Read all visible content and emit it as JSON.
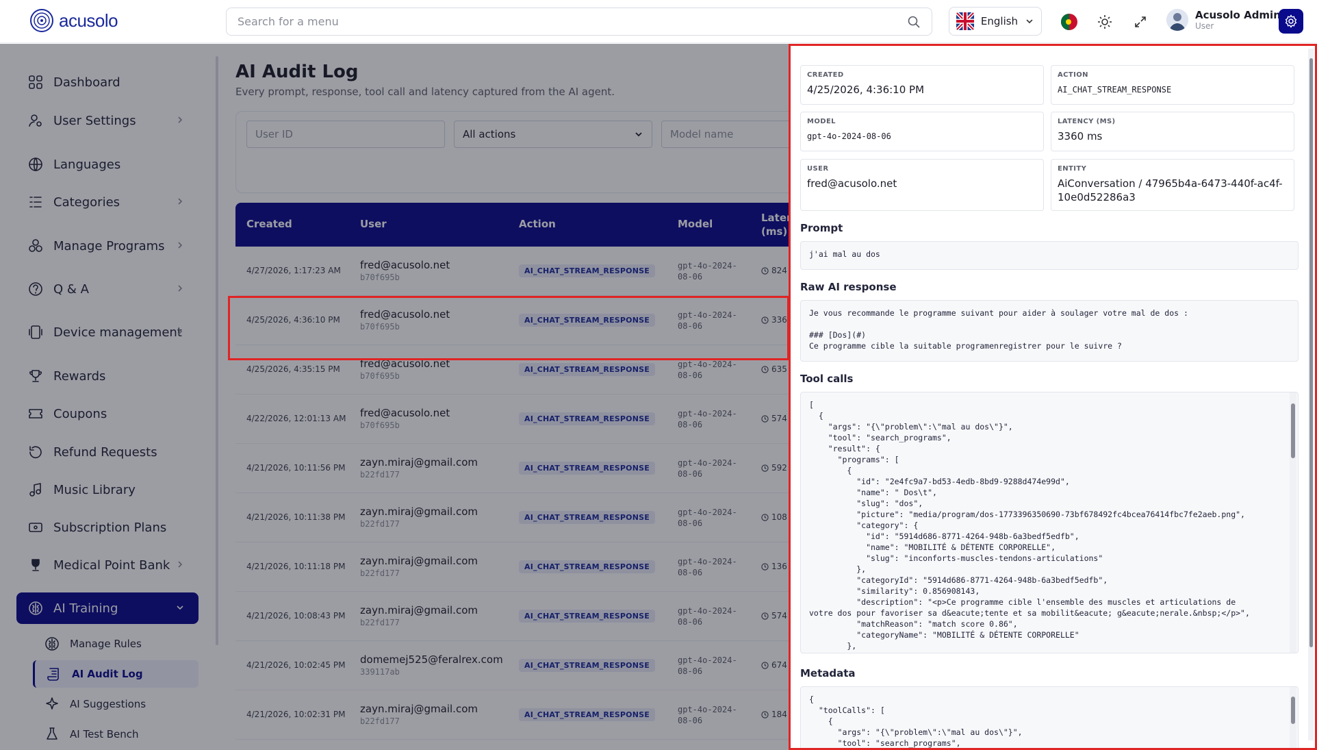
{
  "app": {
    "logo_text": "acusolo",
    "search_placeholder": "Search for a menu",
    "language": "English",
    "user_name": "Acusolo Admin",
    "user_role": "User"
  },
  "sidebar": {
    "items": [
      {
        "label": "Dashboard",
        "icon": "dashboard-icon",
        "chevron": false
      },
      {
        "label": "User Settings",
        "icon": "user-settings-icon",
        "chevron": true
      },
      {
        "label": "Languages",
        "icon": "globe-icon",
        "chevron": false
      },
      {
        "label": "Categories",
        "icon": "categories-icon",
        "chevron": true
      },
      {
        "label": "Manage Programs",
        "icon": "programs-icon",
        "chevron": true
      },
      {
        "label": "Q & A",
        "icon": "qa-icon",
        "chevron": true
      },
      {
        "label": "Device management",
        "icon": "device-icon",
        "chevron": true
      },
      {
        "label": "Rewards",
        "icon": "trophy-icon",
        "chevron": false
      },
      {
        "label": "Coupons",
        "icon": "coupon-icon",
        "chevron": false
      },
      {
        "label": "Refund Requests",
        "icon": "refund-icon",
        "chevron": false
      },
      {
        "label": "Music Library",
        "icon": "music-icon",
        "chevron": false
      },
      {
        "label": "Subscription Plans",
        "icon": "subscription-icon",
        "chevron": false
      },
      {
        "label": "Medical Point Bank",
        "icon": "medical-trophy-icon",
        "chevron": true
      },
      {
        "label": "AI Training",
        "icon": "brain-icon",
        "chevron": true,
        "active": true
      }
    ],
    "sub_items": [
      {
        "label": "Manage Rules",
        "icon": "brain-icon"
      },
      {
        "label": "AI Audit Log",
        "icon": "scroll-icon",
        "active": true
      },
      {
        "label": "AI Suggestions",
        "icon": "sparkle-icon"
      },
      {
        "label": "AI Test Bench",
        "icon": "flask-icon"
      }
    ]
  },
  "page": {
    "title": "AI Audit Log",
    "subtitle": "Every prompt, response, tool call and latency captured from the AI agent.",
    "filters": {
      "user_id_placeholder": "User ID",
      "action_selected": "All actions",
      "model_placeholder": "Model name"
    },
    "columns": [
      "Created",
      "User",
      "Action",
      "Model",
      "Laten (ms)"
    ],
    "rows": [
      {
        "created": "4/27/2026, 1:17:23 AM",
        "user": "fred@acusolo.net",
        "uid": "b70f695b",
        "action": "AI_CHAT_STREAM_RESPONSE",
        "model": "gpt-4o-2024-08-06",
        "latency": "824"
      },
      {
        "created": "4/25/2026, 4:36:10 PM",
        "user": "fred@acusolo.net",
        "uid": "b70f695b",
        "action": "AI_CHAT_STREAM_RESPONSE",
        "model": "gpt-4o-2024-08-06",
        "latency": "336"
      },
      {
        "created": "4/25/2026, 4:35:15 PM",
        "user": "fred@acusolo.net",
        "uid": "b70f695b",
        "action": "AI_CHAT_STREAM_RESPONSE",
        "model": "gpt-4o-2024-08-06",
        "latency": "635"
      },
      {
        "created": "4/22/2026, 12:01:13 AM",
        "user": "fred@acusolo.net",
        "uid": "b70f695b",
        "action": "AI_CHAT_STREAM_RESPONSE",
        "model": "gpt-4o-2024-08-06",
        "latency": "574"
      },
      {
        "created": "4/21/2026, 10:11:56 PM",
        "user": "zayn.miraj@gmail.com",
        "uid": "b22fd177",
        "action": "AI_CHAT_STREAM_RESPONSE",
        "model": "gpt-4o-2024-08-06",
        "latency": "592"
      },
      {
        "created": "4/21/2026, 10:11:38 PM",
        "user": "zayn.miraj@gmail.com",
        "uid": "b22fd177",
        "action": "AI_CHAT_STREAM_RESPONSE",
        "model": "gpt-4o-2024-08-06",
        "latency": "108"
      },
      {
        "created": "4/21/2026, 10:11:18 PM",
        "user": "zayn.miraj@gmail.com",
        "uid": "b22fd177",
        "action": "AI_CHAT_STREAM_RESPONSE",
        "model": "gpt-4o-2024-08-06",
        "latency": "136"
      },
      {
        "created": "4/21/2026, 10:08:43 PM",
        "user": "zayn.miraj@gmail.com",
        "uid": "b22fd177",
        "action": "AI_CHAT_STREAM_RESPONSE",
        "model": "gpt-4o-2024-08-06",
        "latency": "574"
      },
      {
        "created": "4/21/2026, 10:02:45 PM",
        "user": "domemej525@feralrex.com",
        "uid": "339117ab",
        "action": "AI_CHAT_STREAM_RESPONSE",
        "model": "gpt-4o-2024-08-06",
        "latency": "674"
      },
      {
        "created": "4/21/2026, 10:02:31 PM",
        "user": "zayn.miraj@gmail.com",
        "uid": "b22fd177",
        "action": "AI_CHAT_STREAM_RESPONSE",
        "model": "gpt-4o-2024-08-06",
        "latency": "184"
      }
    ]
  },
  "drawer": {
    "created_label": "CREATED",
    "created": "4/25/2026, 4:36:10 PM",
    "action_label": "ACTION",
    "action": "AI_CHAT_STREAM_RESPONSE",
    "model_label": "MODEL",
    "model": "gpt-4o-2024-08-06",
    "latency_label": "LATENCY (MS)",
    "latency": "3360 ms",
    "user_label": "USER",
    "user": "fred@acusolo.net",
    "entity_label": "ENTITY",
    "entity": "AiConversation / 47965b4a-6473-440f-ac4f-10e0d52286a3",
    "prompt_title": "Prompt",
    "prompt": "j'ai mal au dos",
    "raw_title": "Raw AI response",
    "raw": "Je vous recommande le programme suivant pour aider à soulager votre mal de dos :\n\n### [Dos](#)\nCe programme cible la suitable programenregistrer pour le suivre ?",
    "tool_title": "Tool calls",
    "tool_calls": "[\n  {\n    \"args\": \"{\\\"problem\\\":\\\"mal au dos\\\"}\",\n    \"tool\": \"search_programs\",\n    \"result\": {\n      \"programs\": [\n        {\n          \"id\": \"2e4fc9a7-bd53-4edb-8bd9-9288d474e99d\",\n          \"name\": \" Dos\\t\",\n          \"slug\": \"dos\",\n          \"picture\": \"media/program/dos-1773396350690-73bf678492fc4bcea76414fbc7fe2aeb.png\",\n          \"category\": {\n            \"id\": \"5914d686-8771-4264-948b-6a3bedf5edfb\",\n            \"name\": \"MOBILITÉ & DÉTENTE CORPORELLE\",\n            \"slug\": \"inconforts-muscles-tendons-articulations\"\n          },\n          \"categoryId\": \"5914d686-8771-4264-948b-6a3bedf5edfb\",\n          \"similarity\": 0.856908143,\n          \"description\": \"<p>Ce programme cible l'ensemble des muscles et articulations de\nvotre dos pour favoriser sa d&eacute;tente et sa mobilit&eacute; g&eacute;nerale.&nbsp;</p>\",\n          \"matchReason\": \"match score 0.86\",\n          \"categoryName\": \"MOBILITÉ & DÉTENTE CORPORELLE\"\n        },",
    "meta_title": "Metadata",
    "metadata": "{\n  \"toolCalls\": [\n    {\n      \"args\": \"{\\\"problem\\\":\\\"mal au dos\\\"}\",\n      \"tool\": \"search_programs\","
  }
}
